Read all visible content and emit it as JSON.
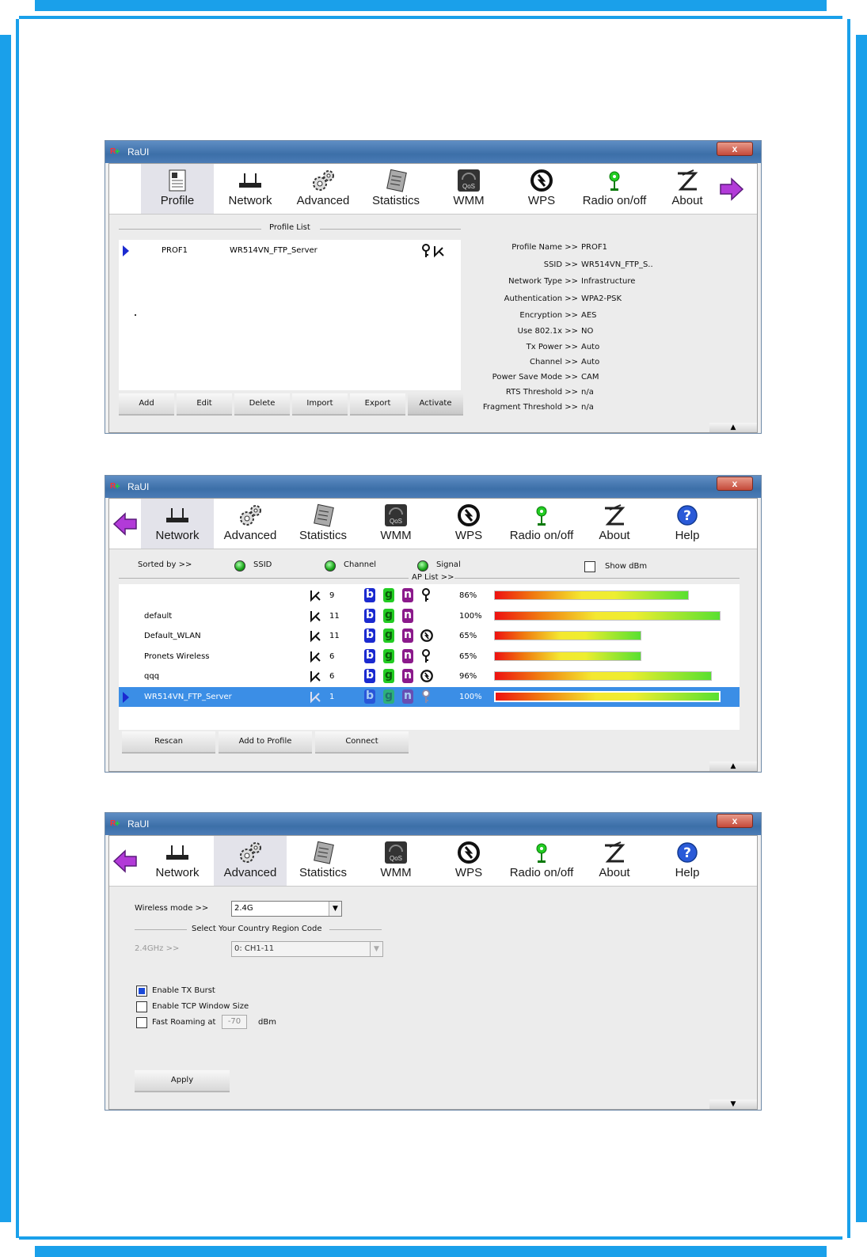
{
  "app_title": "RaUI",
  "close_label": "x",
  "window1": {
    "toolbar": [
      "Profile",
      "Network",
      "Advanced",
      "Statistics",
      "WMM",
      "WPS",
      "Radio on/off",
      "About"
    ],
    "profile_list_label": "Profile List",
    "profiles": [
      {
        "name": "PROF1",
        "ssid": "WR514VN_FTP_Server"
      }
    ],
    "buttons": [
      "Add",
      "Edit",
      "Delete",
      "Import",
      "Export",
      "Activate"
    ],
    "details": [
      {
        "label": "Profile Name >>",
        "value": "PROF1"
      },
      {
        "label": "SSID >>",
        "value": "WR514VN_FTP_S.."
      },
      {
        "label": "Network Type >>",
        "value": "Infrastructure"
      },
      {
        "label": "Authentication >>",
        "value": "WPA2-PSK"
      },
      {
        "label": "Encryption >>",
        "value": "AES"
      },
      {
        "label": "Use 802.1x >>",
        "value": "NO"
      },
      {
        "label": "Tx Power >>",
        "value": "Auto"
      },
      {
        "label": "Channel >>",
        "value": "Auto"
      },
      {
        "label": "Power Save Mode >>",
        "value": "CAM"
      },
      {
        "label": "RTS Threshold >>",
        "value": "n/a"
      },
      {
        "label": "Fragment Threshold >>",
        "value": "n/a"
      }
    ],
    "expand_glyph": "▲"
  },
  "window2": {
    "toolbar": [
      "Network",
      "Advanced",
      "Statistics",
      "WMM",
      "WPS",
      "Radio on/off",
      "About",
      "Help"
    ],
    "sorted_by": "Sorted by >>",
    "sort_options": [
      "SSID",
      "Channel",
      "Signal"
    ],
    "show_dbm": "Show dBm",
    "ap_list_label": "AP List >>",
    "aps": [
      {
        "ssid": "",
        "channel": "9",
        "lock": true,
        "wps": false,
        "signal": "86%",
        "fill": 0.86
      },
      {
        "ssid": "default",
        "channel": "11",
        "lock": false,
        "wps": false,
        "signal": "100%",
        "fill": 1.0
      },
      {
        "ssid": "Default_WLAN",
        "channel": "11",
        "lock": false,
        "wps": true,
        "signal": "65%",
        "fill": 0.65
      },
      {
        "ssid": "Pronets Wireless",
        "channel": "6",
        "lock": true,
        "wps": false,
        "signal": "65%",
        "fill": 0.65
      },
      {
        "ssid": "qqq",
        "channel": "6",
        "lock": false,
        "wps": true,
        "signal": "96%",
        "fill": 0.96
      },
      {
        "ssid": "WR514VN_FTP_Server",
        "channel": "1",
        "lock": true,
        "wps": false,
        "signal": "100%",
        "fill": 1.0
      }
    ],
    "buttons": [
      "Rescan",
      "Add to Profile",
      "Connect"
    ],
    "expand_glyph": "▲"
  },
  "window3": {
    "toolbar": [
      "Network",
      "Advanced",
      "Statistics",
      "WMM",
      "WPS",
      "Radio on/off",
      "About",
      "Help"
    ],
    "wireless_mode_label": "Wireless mode >>",
    "wireless_mode_value": "2.4G",
    "country_region_label": "Select Your Country Region Code",
    "band_label": "2.4GHz >>",
    "band_value": "0: CH1-11",
    "options": [
      {
        "label": "Enable TX Burst",
        "checked": true
      },
      {
        "label": "Enable TCP Window Size",
        "checked": false
      },
      {
        "label": "Fast Roaming at",
        "checked": false
      }
    ],
    "roaming_value": "-70",
    "roaming_unit": "dBm",
    "apply": "Apply",
    "expand_glyph": "▼"
  },
  "colors": {
    "frame": "#1aa0ea",
    "selection": "#3b8ee6"
  }
}
